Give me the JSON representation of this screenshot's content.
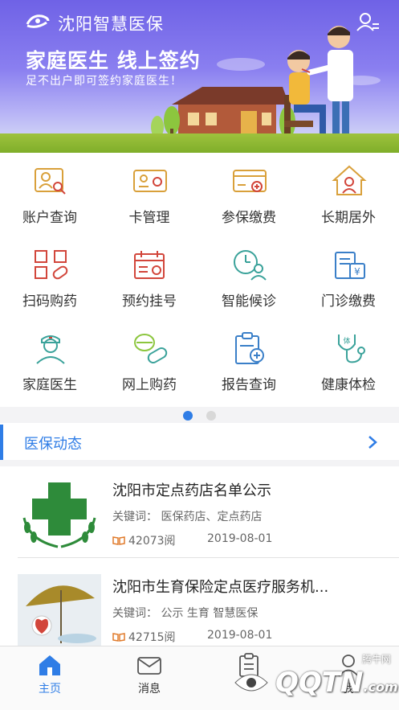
{
  "header": {
    "app_title": "沈阳智慧医保",
    "headline": "家庭医生 线上签约",
    "subline": "足不出户即可签约家庭医生！"
  },
  "grid": [
    {
      "label": "账户查询",
      "icon": "account-query-icon"
    },
    {
      "label": "卡管理",
      "icon": "card-manage-icon"
    },
    {
      "label": "参保缴费",
      "icon": "insurance-pay-icon"
    },
    {
      "label": "长期居外",
      "icon": "long-term-abroad-icon"
    },
    {
      "label": "扫码购药",
      "icon": "scan-buy-medicine-icon"
    },
    {
      "label": "预约挂号",
      "icon": "appointment-icon"
    },
    {
      "label": "智能候诊",
      "icon": "smart-waiting-icon"
    },
    {
      "label": "门诊缴费",
      "icon": "outpatient-pay-icon"
    },
    {
      "label": "家庭医生",
      "icon": "family-doctor-icon"
    },
    {
      "label": "网上购药",
      "icon": "online-medicine-icon"
    },
    {
      "label": "报告查询",
      "icon": "report-query-icon"
    },
    {
      "label": "健康体检",
      "icon": "health-checkup-icon"
    }
  ],
  "pager": {
    "active_index": 0,
    "count": 2,
    "active_color": "#2f7de6",
    "inactive_color": "#d8d8d8"
  },
  "section": {
    "title": "医保动态"
  },
  "news": [
    {
      "title": "沈阳市定点药店名单公示",
      "keywords": "关键词：  医保药店、定点药店",
      "views": "42073阅",
      "date": "2019-08-01"
    },
    {
      "title": "沈阳市生育保险定点医疗服务机...",
      "keywords": "关键词：  公示  生育  智慧医保",
      "views": "42715阅",
      "date": "2019-08-01"
    }
  ],
  "tabs": [
    {
      "label": "主页",
      "icon": "home-icon",
      "active": true
    },
    {
      "label": "消息",
      "icon": "message-icon",
      "active": false
    },
    {
      "label": "",
      "icon": "clipboard-icon",
      "active": false
    },
    {
      "label": "我",
      "icon": "profile-icon",
      "active": false
    }
  ],
  "watermark": {
    "text": "QQTN",
    "suffix": ".com",
    "small": "腾牛网"
  },
  "colors": {
    "accent": "#2f7de6",
    "icon_orange": "#d9a03a",
    "icon_red": "#d2463b",
    "icon_teal": "#3aa29a",
    "banner": "#6f62e6"
  }
}
